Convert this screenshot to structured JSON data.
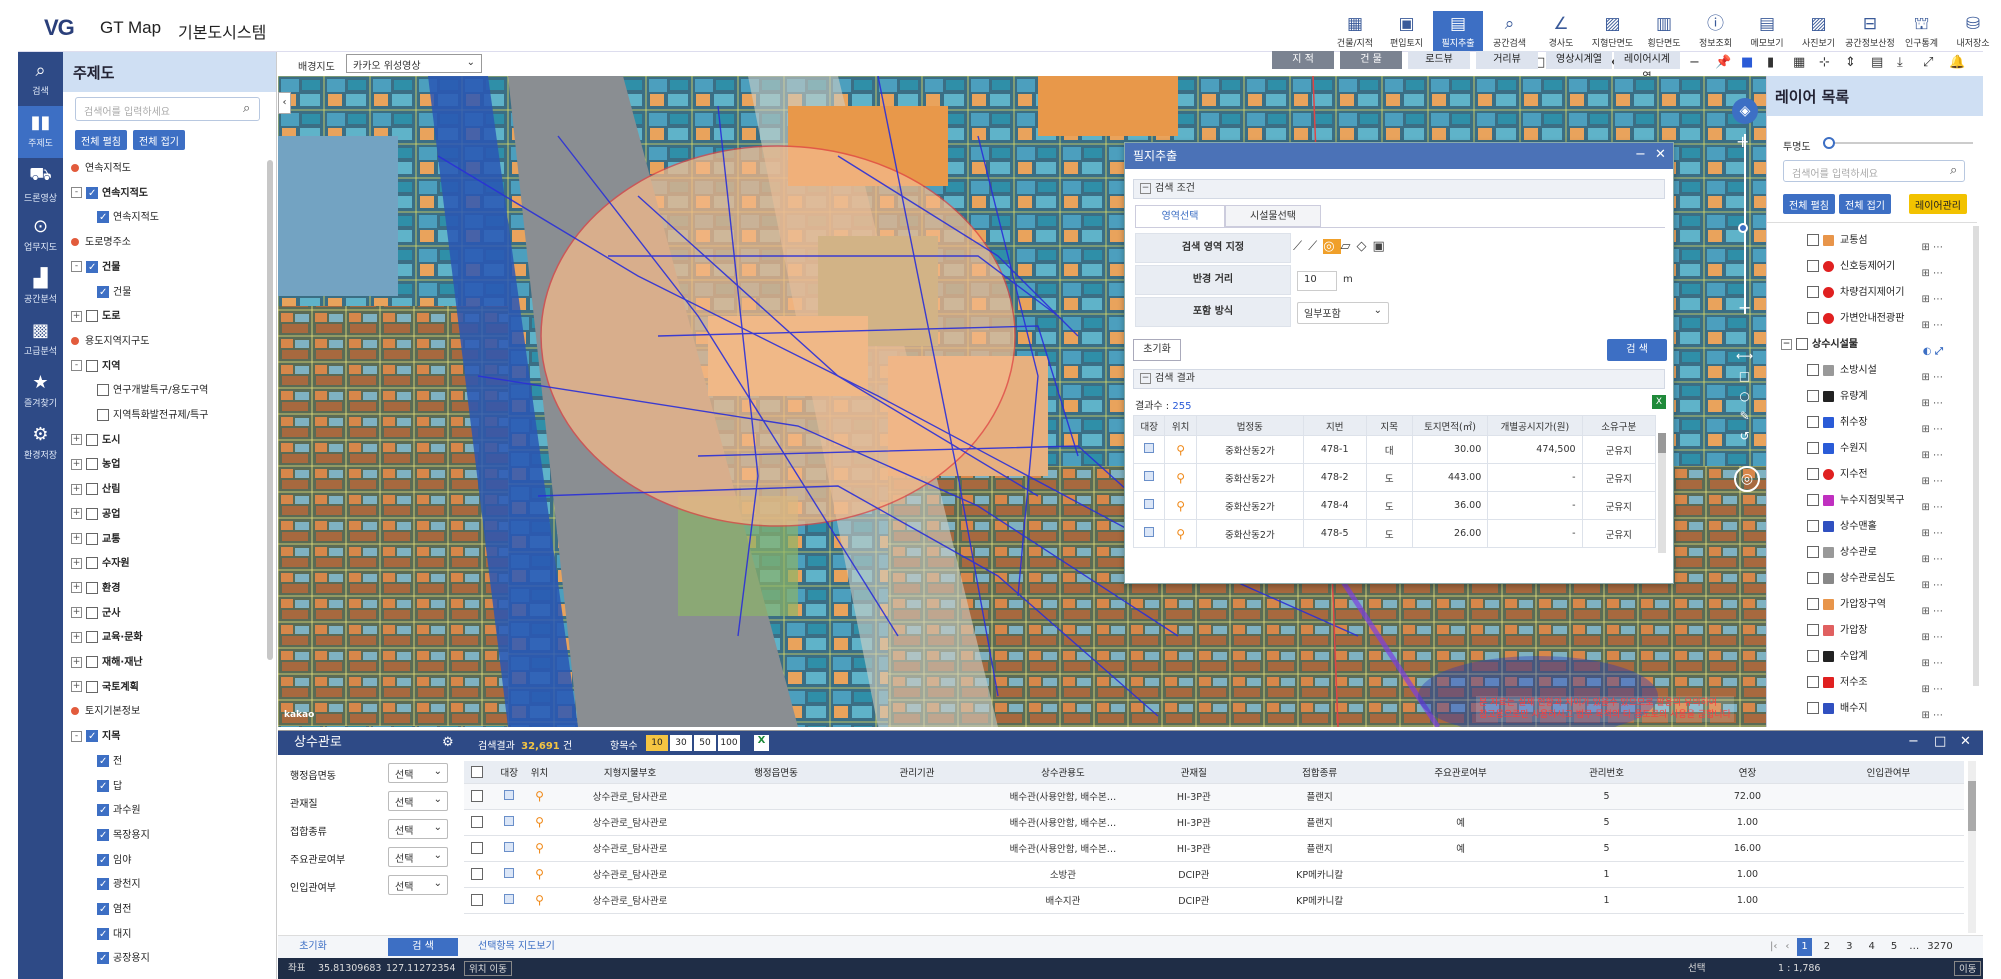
{
  "header": {
    "logo": "VG",
    "app_title": "GT Map",
    "app_subtitle": "기본도시스템",
    "tools": [
      "건물/지적",
      "편입토지",
      "필지추출",
      "공간검색",
      "경사도",
      "지형단면도",
      "횡단면도",
      "정보조회",
      "메모보기",
      "사진보기",
      "공간정보산정",
      "인구통계",
      "내저장소"
    ]
  },
  "rail": [
    "검색",
    "주제도",
    "드론영상",
    "업무지도",
    "공간분석",
    "고급분석",
    "즐겨찾기",
    "환경저장"
  ],
  "theme": {
    "title": "주제도",
    "search_placeholder": "검색어를 입력하세요",
    "expand_all": "전체 펼침",
    "collapse_all": "전체 접기",
    "rows": [
      {
        "t": "연속지적도",
        "kind": "grp"
      },
      {
        "t": "연속지적도",
        "kind": "item",
        "cb": true,
        "exp": "-"
      },
      {
        "t": "연속지적도",
        "kind": "sub",
        "cb": true
      },
      {
        "t": "도로명주소",
        "kind": "grp"
      },
      {
        "t": "건물",
        "kind": "item",
        "cb": true,
        "exp": "-"
      },
      {
        "t": "건물",
        "kind": "sub",
        "cb": true
      },
      {
        "t": "도로",
        "kind": "item",
        "cb": false,
        "exp": "+"
      },
      {
        "t": "용도지역지구도",
        "kind": "grp"
      },
      {
        "t": "지역",
        "kind": "item",
        "cb": false,
        "exp": "-"
      },
      {
        "t": "연구개발특구/용도구역",
        "kind": "sub",
        "cb": false
      },
      {
        "t": "지역특화발전규제/특구",
        "kind": "sub",
        "cb": false
      },
      {
        "t": "도시",
        "kind": "item",
        "cb": false,
        "exp": "+"
      },
      {
        "t": "농업",
        "kind": "item",
        "cb": false,
        "exp": "+"
      },
      {
        "t": "산림",
        "kind": "item",
        "cb": false,
        "exp": "+"
      },
      {
        "t": "공업",
        "kind": "item",
        "cb": false,
        "exp": "+"
      },
      {
        "t": "교통",
        "kind": "item",
        "cb": false,
        "exp": "+"
      },
      {
        "t": "수자원",
        "kind": "item",
        "cb": false,
        "exp": "+"
      },
      {
        "t": "환경",
        "kind": "item",
        "cb": false,
        "exp": "+"
      },
      {
        "t": "군사",
        "kind": "item",
        "cb": false,
        "exp": "+"
      },
      {
        "t": "교육·문화",
        "kind": "item",
        "cb": false,
        "exp": "+"
      },
      {
        "t": "재해·재난",
        "kind": "item",
        "cb": false,
        "exp": "+"
      },
      {
        "t": "국토계획",
        "kind": "item",
        "cb": false,
        "exp": "+"
      },
      {
        "t": "토지기본정보",
        "kind": "grp"
      },
      {
        "t": "지목",
        "kind": "item",
        "cb": true,
        "exp": "-"
      },
      {
        "t": "전",
        "kind": "sub",
        "cb": true
      },
      {
        "t": "답",
        "kind": "sub",
        "cb": true
      },
      {
        "t": "과수원",
        "kind": "sub",
        "cb": true
      },
      {
        "t": "목장용지",
        "kind": "sub",
        "cb": true
      },
      {
        "t": "임야",
        "kind": "sub",
        "cb": true
      },
      {
        "t": "광천지",
        "kind": "sub",
        "cb": true
      },
      {
        "t": "염전",
        "kind": "sub",
        "cb": true
      },
      {
        "t": "대지",
        "kind": "sub",
        "cb": true
      },
      {
        "t": "공장용지",
        "kind": "sub",
        "cb": true
      }
    ]
  },
  "mapbar": {
    "bg_label": "배경지도",
    "bg_value": "카카오 위성영상",
    "tabs": [
      "지 적",
      "건 물",
      "로드뷰",
      "거리뷰",
      "영상시계열",
      "레이어시계열"
    ]
  },
  "dialog": {
    "title": "필지추출",
    "cond_title": "검색 조건",
    "tab1": "영역선택",
    "tab2": "시설물선택",
    "area_label": "검색 영역 지정",
    "radius_label": "반경 거리",
    "radius_value": "10",
    "radius_unit": "m",
    "mode_label": "포함 방식",
    "mode_value": "일부포함",
    "reset": "초기화",
    "search": "검 색",
    "result_title": "검색 결과",
    "result_count_label": "결과수 :",
    "result_count": "255",
    "cols": [
      "대장",
      "위치",
      "법정동",
      "지번",
      "지목",
      "토지면적(㎡)",
      "개별공시지가(원)",
      "소유구분"
    ],
    "rows": [
      [
        "중화산동2가",
        "478-1",
        "대",
        "30.00",
        "474,500",
        "군유지"
      ],
      [
        "중화산동2가",
        "478-2",
        "도",
        "443.00",
        "-",
        "군유지"
      ],
      [
        "중화산동2가",
        "478-4",
        "도",
        "36.00",
        "-",
        "군유지"
      ],
      [
        "중화산동2가",
        "478-5",
        "도",
        "26.00",
        "-",
        "군유지"
      ]
    ]
  },
  "layers": {
    "title": "레이어 목록",
    "opacity_label": "투명도",
    "search_placeholder": "검색어를 입력하세요",
    "expand_all": "전체 펼침",
    "collapse_all": "전체 접기",
    "manage": "레이어관리",
    "group": "상수시설물",
    "rows": [
      {
        "t": "교통섬",
        "c": "#e8954a"
      },
      {
        "t": "신호등제어기",
        "c": "#e02020"
      },
      {
        "t": "차량검지제어기",
        "c": "#e02020"
      },
      {
        "t": "가변안내전광판",
        "c": "#e02020"
      },
      {
        "t": "소방시설",
        "c": "#999"
      },
      {
        "t": "유량계",
        "c": "#222"
      },
      {
        "t": "취수장",
        "c": "#2a5bd7"
      },
      {
        "t": "수원지",
        "c": "#2a5bd7"
      },
      {
        "t": "지수전",
        "c": "#e02020"
      },
      {
        "t": "누수지점및복구",
        "c": "#c030c0"
      },
      {
        "t": "상수맨홀",
        "c": "#3050c0"
      },
      {
        "t": "상수관로",
        "c": "#999"
      },
      {
        "t": "상수관로심도",
        "c": "#888"
      },
      {
        "t": "가압장구역",
        "c": "#e8954a"
      },
      {
        "t": "가압장",
        "c": "#e06060"
      },
      {
        "t": "수압계",
        "c": "#222"
      },
      {
        "t": "저수조",
        "c": "#e02020"
      },
      {
        "t": "배수지",
        "c": "#3050c0"
      }
    ]
  },
  "bottom": {
    "title": "상수관로",
    "result_label": "검색결과",
    "result_count": "32,691",
    "result_unit": "건",
    "page_label": "항목수",
    "page_sizes": [
      "10",
      "30",
      "50",
      "100"
    ],
    "filters": [
      {
        "l": "행정읍면동",
        "v": "선택"
      },
      {
        "l": "관재질",
        "v": "선택"
      },
      {
        "l": "접합종류",
        "v": "선택"
      },
      {
        "l": "주요관로여부",
        "v": "선택"
      },
      {
        "l": "인입관여부",
        "v": "선택"
      }
    ],
    "cols": [
      "대장",
      "위치",
      "지형지물부호",
      "행정읍면동",
      "관리기관",
      "상수관용도",
      "관재질",
      "접합종류",
      "주요관로여부",
      "관리번호",
      "연장",
      "인입관여부"
    ],
    "rows": [
      [
        "상수관로_탐사관로",
        "",
        "",
        "배수관(사용안함, 배수본…",
        "HI-3P관",
        "플랜지",
        "",
        "5",
        "72.00",
        ""
      ],
      [
        "상수관로_탐사관로",
        "",
        "",
        "배수관(사용안함, 배수본…",
        "HI-3P관",
        "플랜지",
        "예",
        "5",
        "1.00",
        ""
      ],
      [
        "상수관로_탐사관로",
        "",
        "",
        "배수관(사용안함, 배수본…",
        "HI-3P관",
        "플랜지",
        "예",
        "5",
        "16.00",
        ""
      ],
      [
        "상수관로_탐사관로",
        "",
        "",
        "소방관",
        "DCIP관",
        "KP메카니칼",
        "",
        "1",
        "1.00",
        ""
      ],
      [
        "상수관로_탐사관로",
        "",
        "",
        "배수지관",
        "DCIP관",
        "KP메카니칼",
        "",
        "1",
        "1.00",
        ""
      ]
    ],
    "reset": "초기화",
    "search": "검 색",
    "show_map": "선택항목 지도보기",
    "pages": [
      "1",
      "2",
      "3",
      "4",
      "5",
      "3270"
    ]
  },
  "status": {
    "coord_label": "좌표",
    "lat": "35.81309683",
    "lng": "127.11272354",
    "move": "위치 이동",
    "select": "선택",
    "scale": "1 : 1,786",
    "move2": "이동"
  },
  "map_notice1": "본 자료는 실제 현황과 차이가 있을수 있으므로 활용의 유의하여",
  "map_notice2": "참고용으로만 사용하시고 법무 목적의 타 용도로의 사용을 금합니다",
  "kakao": "kakao"
}
